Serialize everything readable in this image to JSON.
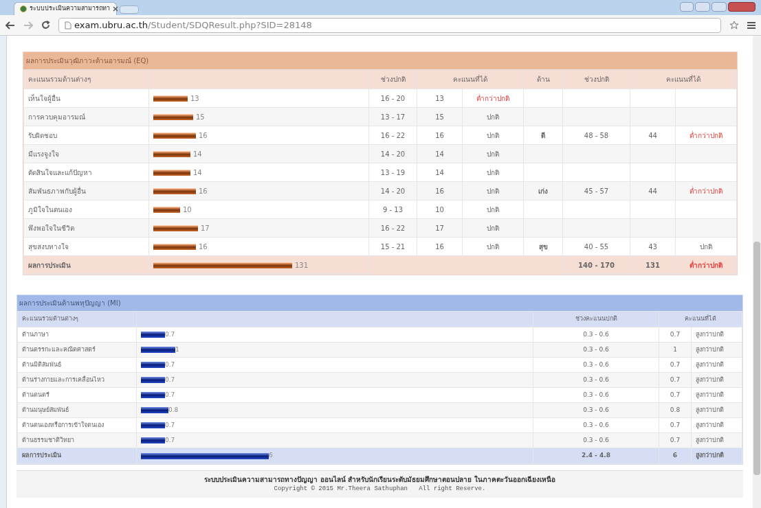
{
  "browser": {
    "tab_title": "ระบบประเมินความสามารถทา",
    "url_host": "exam.ubru.ac.th",
    "url_path": "/Student/SDQResult.php?SID=28148"
  },
  "eq": {
    "title": "ผลการประเมินวุฒิภาวะด้านอารมณ์ (EQ)",
    "columns": [
      "คะแนนรวมด้านต่างๆ",
      "ช่วงปกติ",
      "คะแนนที่ได้",
      "ด้าน",
      "ช่วงปกติ",
      "คะแนนที่ได้"
    ],
    "rows": [
      {
        "name": "เห็นใจผู้อื่น",
        "bar_label": "13",
        "range": "16 - 20",
        "score": "13",
        "status": "ต่ำกว่าปกติ",
        "below_normal": true
      },
      {
        "name": "การควบคุมอารมณ์",
        "bar_label": "15",
        "range": "13 - 17",
        "score": "15",
        "status": "ปกติ",
        "below_normal": false
      },
      {
        "name": "รับผิดชอบ",
        "bar_label": "16",
        "range": "16 - 22",
        "score": "16",
        "status": "ปกติ",
        "below_normal": false,
        "aspect": {
          "name": "ดี",
          "range": "48 - 58",
          "score": "44",
          "status": "ต่ำกว่าปกติ",
          "below_normal": true
        }
      },
      {
        "name": "มีแรงจูงใจ",
        "bar_label": "14",
        "range": "14 - 20",
        "score": "14",
        "status": "ปกติ",
        "below_normal": false
      },
      {
        "name": "ตัดสินใจและแก้ปัญหา",
        "bar_label": "14",
        "range": "13 - 19",
        "score": "14",
        "status": "ปกติ",
        "below_normal": false
      },
      {
        "name": "สัมพันธภาพกับผู้อื่น",
        "bar_label": "16",
        "range": "14 - 20",
        "score": "16",
        "status": "ปกติ",
        "below_normal": false,
        "aspect": {
          "name": "เก่ง",
          "range": "45 - 57",
          "score": "44",
          "status": "ต่ำกว่าปกติ",
          "below_normal": true
        }
      },
      {
        "name": "ภูมิใจในตนเอง",
        "bar_label": "10",
        "range": "9 - 13",
        "score": "10",
        "status": "ปกติ",
        "below_normal": false
      },
      {
        "name": "พึงพอใจในชีวิต",
        "bar_label": "17",
        "range": "16 - 22",
        "score": "17",
        "status": "ปกติ",
        "below_normal": false
      },
      {
        "name": "สุขสงบทางใจ",
        "bar_label": "16",
        "range": "15 - 21",
        "score": "16",
        "status": "ปกติ",
        "below_normal": false,
        "aspect": {
          "name": "สุข",
          "range": "40 - 55",
          "score": "43",
          "status": "ปกติ",
          "below_normal": false
        }
      }
    ],
    "total": {
      "name": "ผลการประเมิน",
      "bar_label": "131",
      "range": "140 - 170",
      "score": "131",
      "status": "ต่ำกว่าปกติ",
      "below_normal": true
    }
  },
  "mi": {
    "title": "ผลการประเมินด้านพหุปัญญา (MI)",
    "columns": [
      "คะแนนรวมด้านต่างๆ",
      "ช่วงคะแนนปกติ",
      "คะแนนที่ได้"
    ],
    "rows": [
      {
        "name": "ด้านภาษา",
        "bar_label": "0.7",
        "range": "0.3 - 0.6",
        "score": "0.7",
        "status": "สูงกว่าปกติ"
      },
      {
        "name": "ด้านตรรกะและคณิตศาสตร์",
        "bar_label": "1",
        "range": "0.3 - 0.6",
        "score": "1",
        "status": "สูงกว่าปกติ"
      },
      {
        "name": "ด้านมิติสัมพันธ์",
        "bar_label": "0.7",
        "range": "0.3 - 0.6",
        "score": "0.7",
        "status": "สูงกว่าปกติ"
      },
      {
        "name": "ด้านร่างกายและการเคลื่อนไหว",
        "bar_label": "0.7",
        "range": "0.3 - 0.6",
        "score": "0.7",
        "status": "สูงกว่าปกติ"
      },
      {
        "name": "ด้านดนตรี",
        "bar_label": "0.7",
        "range": "0.3 - 0.6",
        "score": "0.7",
        "status": "สูงกว่าปกติ"
      },
      {
        "name": "ด้านมนุษย์สัมพันธ์",
        "bar_label": "0.8",
        "range": "0.3 - 0.6",
        "score": "0.8",
        "status": "สูงกว่าปกติ"
      },
      {
        "name": "ด้านตนเองหรือการเข้าใจตนเอง",
        "bar_label": "0.7",
        "range": "0.3 - 0.6",
        "score": "0.7",
        "status": "สูงกว่าปกติ"
      },
      {
        "name": "ด้านธรรมชาติวิทยา",
        "bar_label": "0.7",
        "range": "0.3 - 0.6",
        "score": "0.7",
        "status": "สูงกว่าปกติ"
      }
    ],
    "total": {
      "name": "ผลการประเมิน",
      "bar_label": "6",
      "range": "2.4 - 4.8",
      "score": "6",
      "status": "สูงกว่าปกติ"
    }
  },
  "footer": {
    "title": "ระบบประเมินความสามารถทางปัญญา ออนไลน์ สำหรับนักเรียนระดับมัธยมศึกษาตอนปลาย ในภาคตะวันออกเฉียงเหนือ",
    "copyright": "Copyright © 2015 Mr.Theera Sathuphan   All right Reserve."
  }
}
